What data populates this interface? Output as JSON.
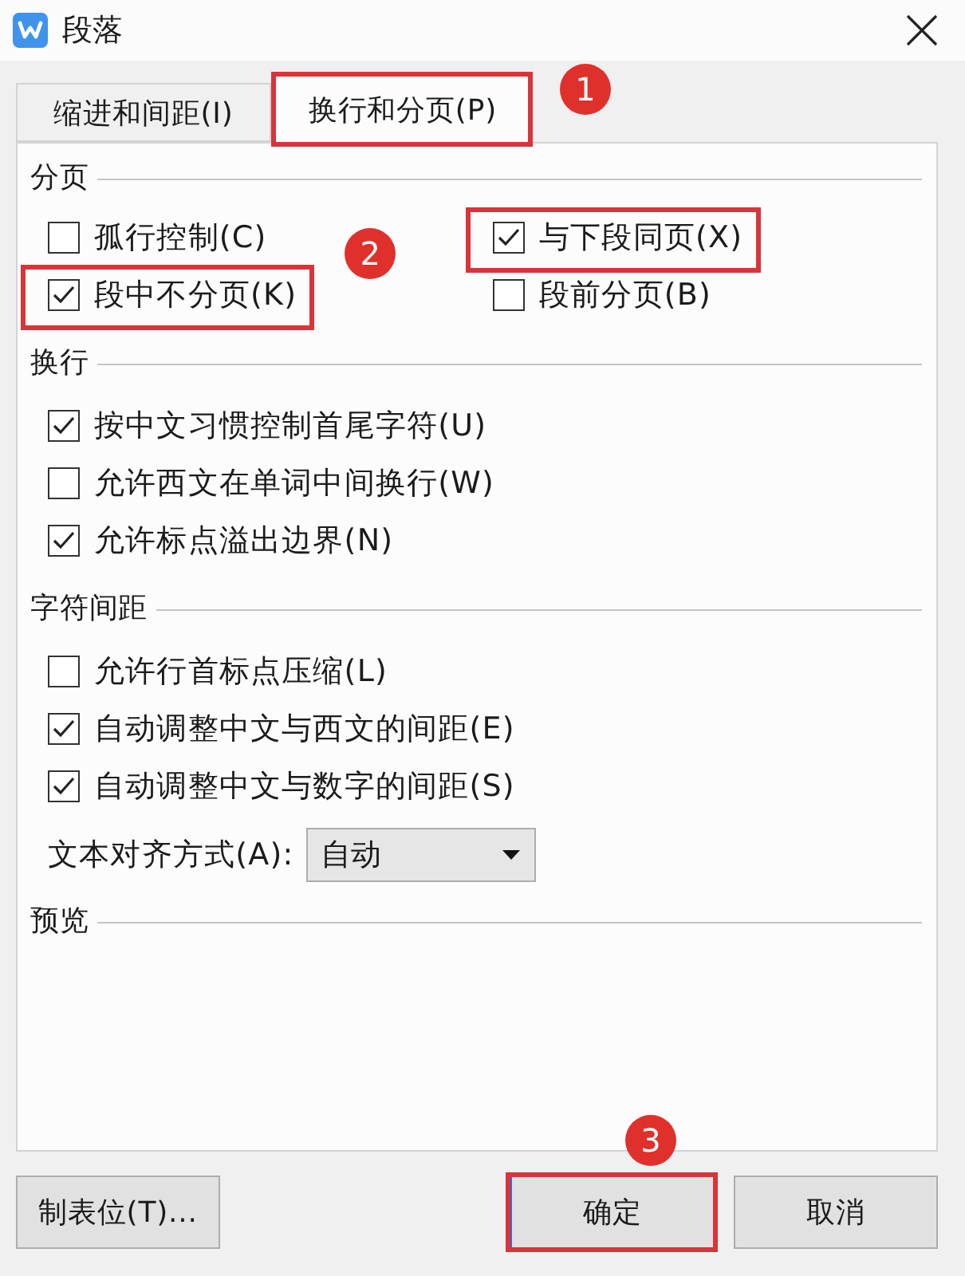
{
  "window": {
    "title": "段落"
  },
  "tabs": [
    {
      "label": "缩进和间距(I)",
      "selected": false,
      "highlighted": false
    },
    {
      "label": "换行和分页(P)",
      "selected": true,
      "highlighted": true,
      "badge": "1"
    }
  ],
  "sections": [
    {
      "title": "分页",
      "kind": "grid",
      "options": [
        {
          "label": "孤行控制(C)",
          "checked": false,
          "highlighted": false
        },
        {
          "label": "与下段同页(X)",
          "checked": true,
          "highlighted": true
        },
        {
          "label": "段中不分页(K)",
          "checked": true,
          "highlighted": true,
          "badge": "2"
        },
        {
          "label": "段前分页(B)",
          "checked": false,
          "highlighted": false
        }
      ]
    },
    {
      "title": "换行",
      "kind": "list",
      "options": [
        {
          "label": "按中文习惯控制首尾字符(U)",
          "checked": true,
          "highlighted": false
        },
        {
          "label": "允许西文在单词中间换行(W)",
          "checked": false,
          "highlighted": false
        },
        {
          "label": "允许标点溢出边界(N)",
          "checked": true,
          "highlighted": false
        }
      ]
    },
    {
      "title": "字符间距",
      "kind": "list",
      "options": [
        {
          "label": "允许行首标点压缩(L)",
          "checked": false,
          "highlighted": false
        },
        {
          "label": "自动调整中文与西文的间距(E)",
          "checked": true,
          "highlighted": false
        },
        {
          "label": "自动调整中文与数字的间距(S)",
          "checked": true,
          "highlighted": false
        }
      ],
      "select": {
        "label": "文本对齐方式(A):",
        "value": "自动"
      }
    },
    {
      "title": "预览",
      "kind": "preview"
    }
  ],
  "buttons": [
    {
      "label": "制表位(T)...",
      "highlighted": false,
      "default": false
    },
    {
      "label": "确定",
      "highlighted": true,
      "default": true,
      "badge": "3"
    },
    {
      "label": "取消",
      "highlighted": false,
      "default": false
    }
  ]
}
